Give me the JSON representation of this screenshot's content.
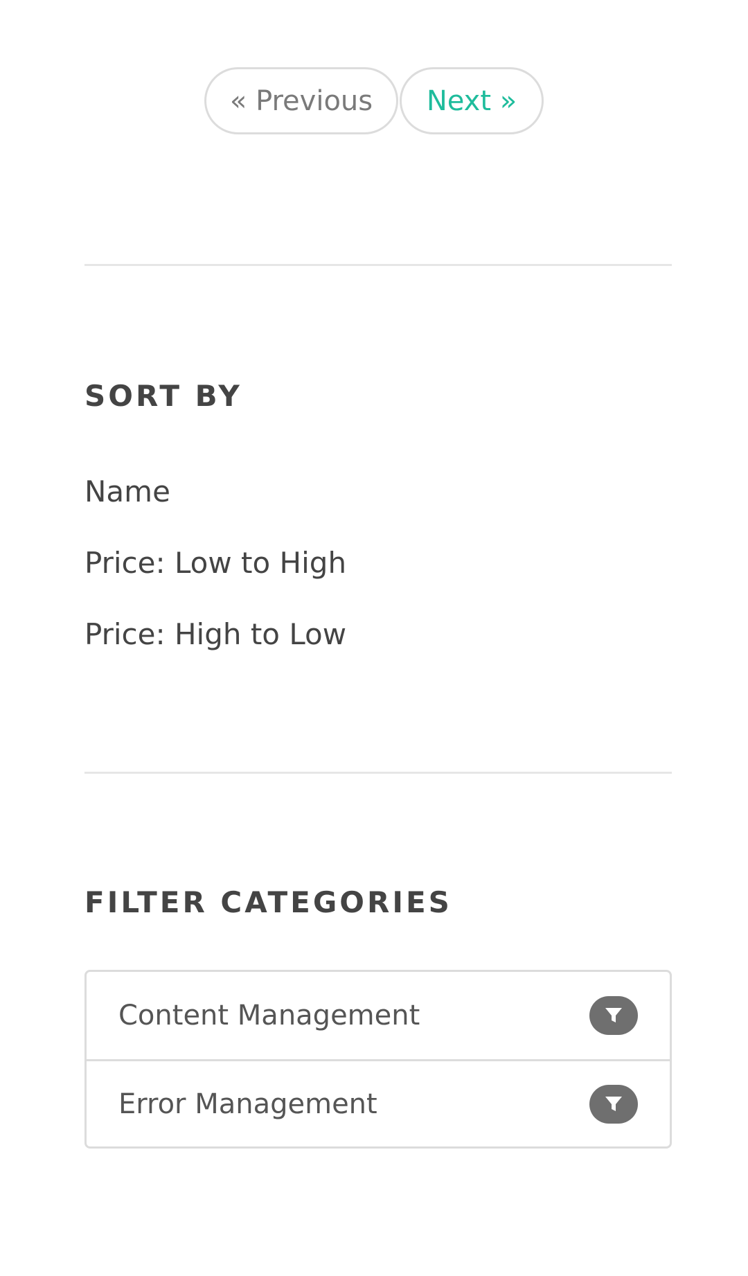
{
  "pagination": {
    "previous_label": "« Previous",
    "next_label": "Next »"
  },
  "sort": {
    "title": "SORT BY",
    "options": [
      {
        "label": "Name"
      },
      {
        "label": "Price: Low to High"
      },
      {
        "label": "Price: High to Low"
      }
    ]
  },
  "filter": {
    "title": "FILTER CATEGORIES",
    "categories": [
      {
        "label": "Content Management",
        "icon": "filter-icon"
      },
      {
        "label": "Error Management",
        "icon": "filter-icon"
      }
    ]
  },
  "colors": {
    "accent": "#1fbc9c",
    "text": "#444444",
    "border": "#dcdcdc",
    "icon_bg": "#6f6f6f"
  }
}
